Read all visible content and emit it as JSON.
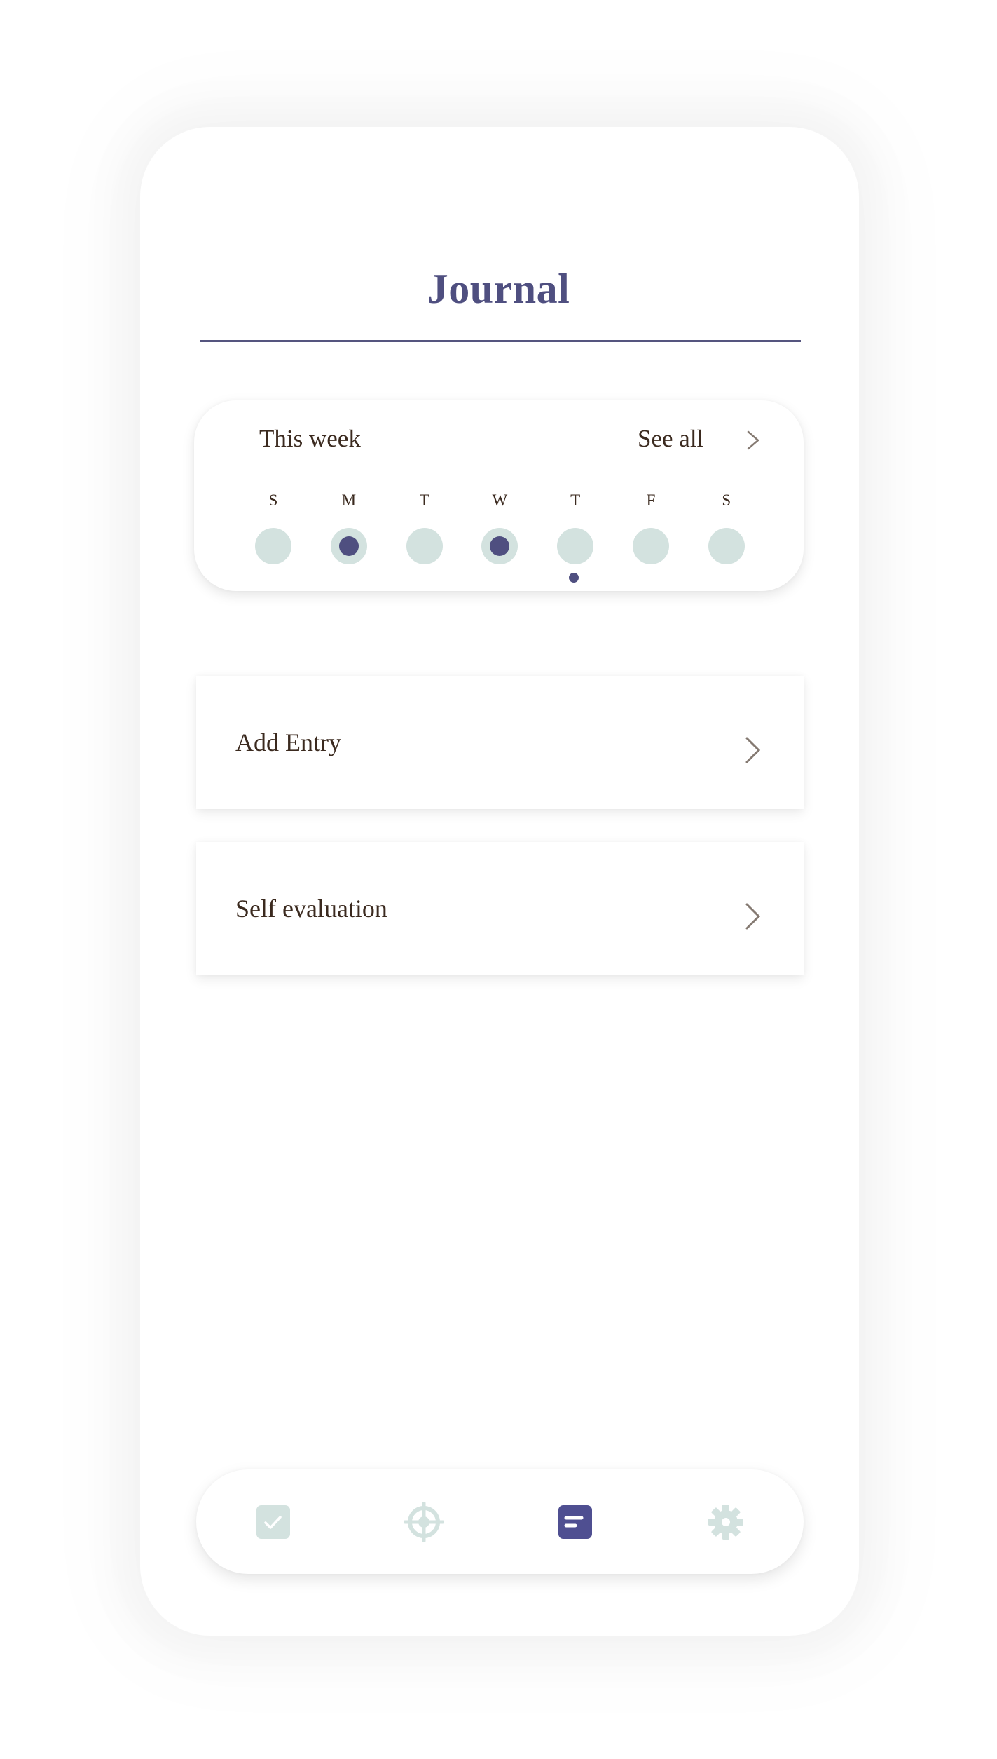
{
  "header": {
    "title": "Journal"
  },
  "week": {
    "title": "This week",
    "see_all_label": "See all",
    "days": [
      {
        "label": "S",
        "has_entry": false,
        "is_today": false
      },
      {
        "label": "M",
        "has_entry": true,
        "is_today": false
      },
      {
        "label": "T",
        "has_entry": false,
        "is_today": false
      },
      {
        "label": "W",
        "has_entry": true,
        "is_today": false
      },
      {
        "label": "T",
        "has_entry": false,
        "is_today": true
      },
      {
        "label": "F",
        "has_entry": false,
        "is_today": false
      },
      {
        "label": "S",
        "has_entry": false,
        "is_today": false
      }
    ]
  },
  "actions": [
    {
      "label": "Add Entry",
      "icon": "chevron-right-icon"
    },
    {
      "label": "Self evaluation",
      "icon": "chevron-right-icon"
    }
  ],
  "nav": {
    "items": [
      {
        "name": "tasks",
        "icon": "checkbox-icon",
        "active": false
      },
      {
        "name": "goals",
        "icon": "target-icon",
        "active": false
      },
      {
        "name": "journal",
        "icon": "journal-icon",
        "active": true
      },
      {
        "name": "settings",
        "icon": "gear-icon",
        "active": false
      }
    ]
  },
  "colors": {
    "accent": "#4f4f80",
    "accent_icon": "#4f4f91",
    "inactive": "#d3e2df",
    "text": "#3b2a1f",
    "chevron": "#857a72"
  }
}
